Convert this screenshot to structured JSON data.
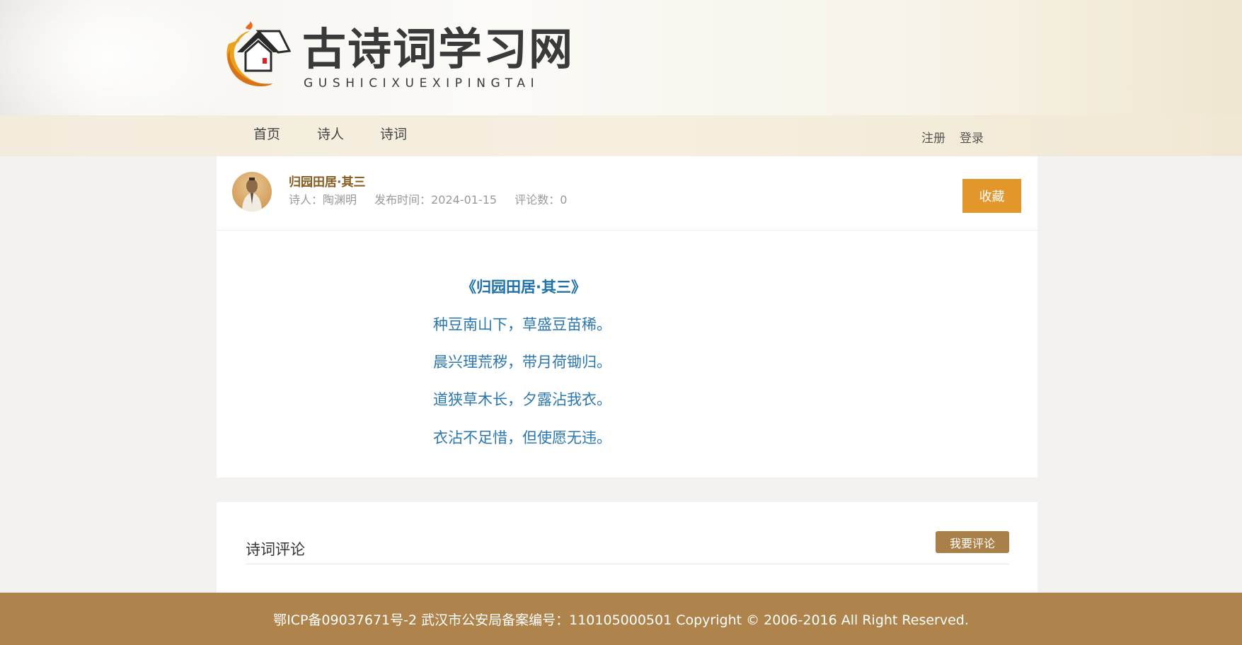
{
  "header": {
    "logo_title": "古诗词学习网",
    "logo_subtitle": "GUSHICIXUEXIPINGTAI"
  },
  "nav": {
    "items": [
      {
        "label": "首页"
      },
      {
        "label": "诗人"
      },
      {
        "label": "诗词"
      }
    ],
    "register_label": "注册",
    "login_label": "登录"
  },
  "poem_header": {
    "avatar_icon": "poet-avatar-icon",
    "title": "归园田居·其三",
    "poet": "诗人：陶渊明",
    "publish_time": "发布时间：2024-01-15",
    "comment_count": "评论数：0",
    "favorite_label": "收藏"
  },
  "poem": {
    "title": "《归园田居·其三》",
    "lines": [
      "种豆南山下，草盛豆苗稀。",
      "晨兴理荒秽，带月荷锄归。",
      "道狭草木长，夕露沾我衣。",
      "衣沾不足惜，但使愿无违。"
    ]
  },
  "comments": {
    "title": "诗词评论",
    "add_label": "我要评论"
  },
  "footer": {
    "text": "鄂ICP备09037671号-2 武汉市公安局备案编号：110105000501 Copyright © 2006-2016 All Right Reserved."
  },
  "colors": {
    "accent_orange": "#e3962a",
    "brown": "#ae834c",
    "poem_blue": "#2a77b0",
    "title_brown": "#8a5a1c"
  }
}
